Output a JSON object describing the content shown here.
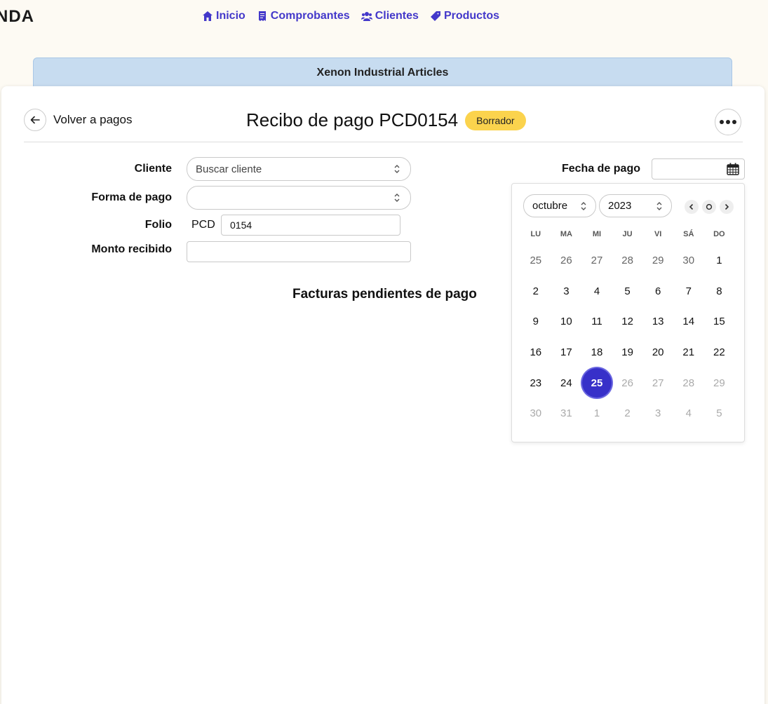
{
  "nav": {
    "logo": "NDA",
    "items": [
      {
        "label": "Inicio",
        "icon": "home-icon"
      },
      {
        "label": "Comprobantes",
        "icon": "receipt-icon"
      },
      {
        "label": "Clientes",
        "icon": "users-icon"
      },
      {
        "label": "Productos",
        "icon": "tag-icon"
      }
    ]
  },
  "banner": {
    "company": "Xenon Industrial Articles"
  },
  "header": {
    "back_label": "Volver a pagos",
    "title": "Recibo de pago PCD0154",
    "status": "Borrador"
  },
  "form": {
    "cliente_label": "Cliente",
    "cliente_placeholder": "Buscar cliente",
    "forma_pago_label": "Forma de pago",
    "forma_pago_value": "",
    "folio_label": "Folio",
    "folio_prefix": "PCD",
    "folio_value": "0154",
    "monto_label": "Monto recibido",
    "monto_value": "",
    "fecha_label": "Fecha de pago",
    "fecha_value": ""
  },
  "section": {
    "pending_title": "Facturas pendientes de pago"
  },
  "datepicker": {
    "month": "octubre",
    "year": "2023",
    "weekdays": [
      "LU",
      "MA",
      "MI",
      "JU",
      "VI",
      "SÁ",
      "DO"
    ],
    "weeks": [
      [
        {
          "d": "25",
          "t": "other"
        },
        {
          "d": "26",
          "t": "other"
        },
        {
          "d": "27",
          "t": "other"
        },
        {
          "d": "28",
          "t": "other"
        },
        {
          "d": "29",
          "t": "other"
        },
        {
          "d": "30",
          "t": "other"
        },
        {
          "d": "1",
          "t": "cur"
        }
      ],
      [
        {
          "d": "2",
          "t": "cur"
        },
        {
          "d": "3",
          "t": "cur"
        },
        {
          "d": "4",
          "t": "cur"
        },
        {
          "d": "5",
          "t": "cur"
        },
        {
          "d": "6",
          "t": "cur"
        },
        {
          "d": "7",
          "t": "cur"
        },
        {
          "d": "8",
          "t": "cur"
        }
      ],
      [
        {
          "d": "9",
          "t": "cur"
        },
        {
          "d": "10",
          "t": "cur"
        },
        {
          "d": "11",
          "t": "cur"
        },
        {
          "d": "12",
          "t": "cur"
        },
        {
          "d": "13",
          "t": "cur"
        },
        {
          "d": "14",
          "t": "cur"
        },
        {
          "d": "15",
          "t": "cur"
        }
      ],
      [
        {
          "d": "16",
          "t": "cur"
        },
        {
          "d": "17",
          "t": "cur"
        },
        {
          "d": "18",
          "t": "cur"
        },
        {
          "d": "19",
          "t": "cur"
        },
        {
          "d": "20",
          "t": "cur"
        },
        {
          "d": "21",
          "t": "cur"
        },
        {
          "d": "22",
          "t": "cur"
        }
      ],
      [
        {
          "d": "23",
          "t": "cur"
        },
        {
          "d": "24",
          "t": "cur"
        },
        {
          "d": "25",
          "t": "selected"
        },
        {
          "d": "26",
          "t": "faded"
        },
        {
          "d": "27",
          "t": "faded"
        },
        {
          "d": "28",
          "t": "faded"
        },
        {
          "d": "29",
          "t": "faded"
        }
      ],
      [
        {
          "d": "30",
          "t": "faded"
        },
        {
          "d": "31",
          "t": "faded"
        },
        {
          "d": "1",
          "t": "faded"
        },
        {
          "d": "2",
          "t": "faded"
        },
        {
          "d": "3",
          "t": "faded"
        },
        {
          "d": "4",
          "t": "faded"
        },
        {
          "d": "5",
          "t": "faded"
        }
      ]
    ]
  },
  "colors": {
    "accent": "#4338ca",
    "selected_day": "#3730c9",
    "badge": "#fbd34d",
    "banner": "#c7dcf0",
    "background": "#fdfaf3"
  }
}
